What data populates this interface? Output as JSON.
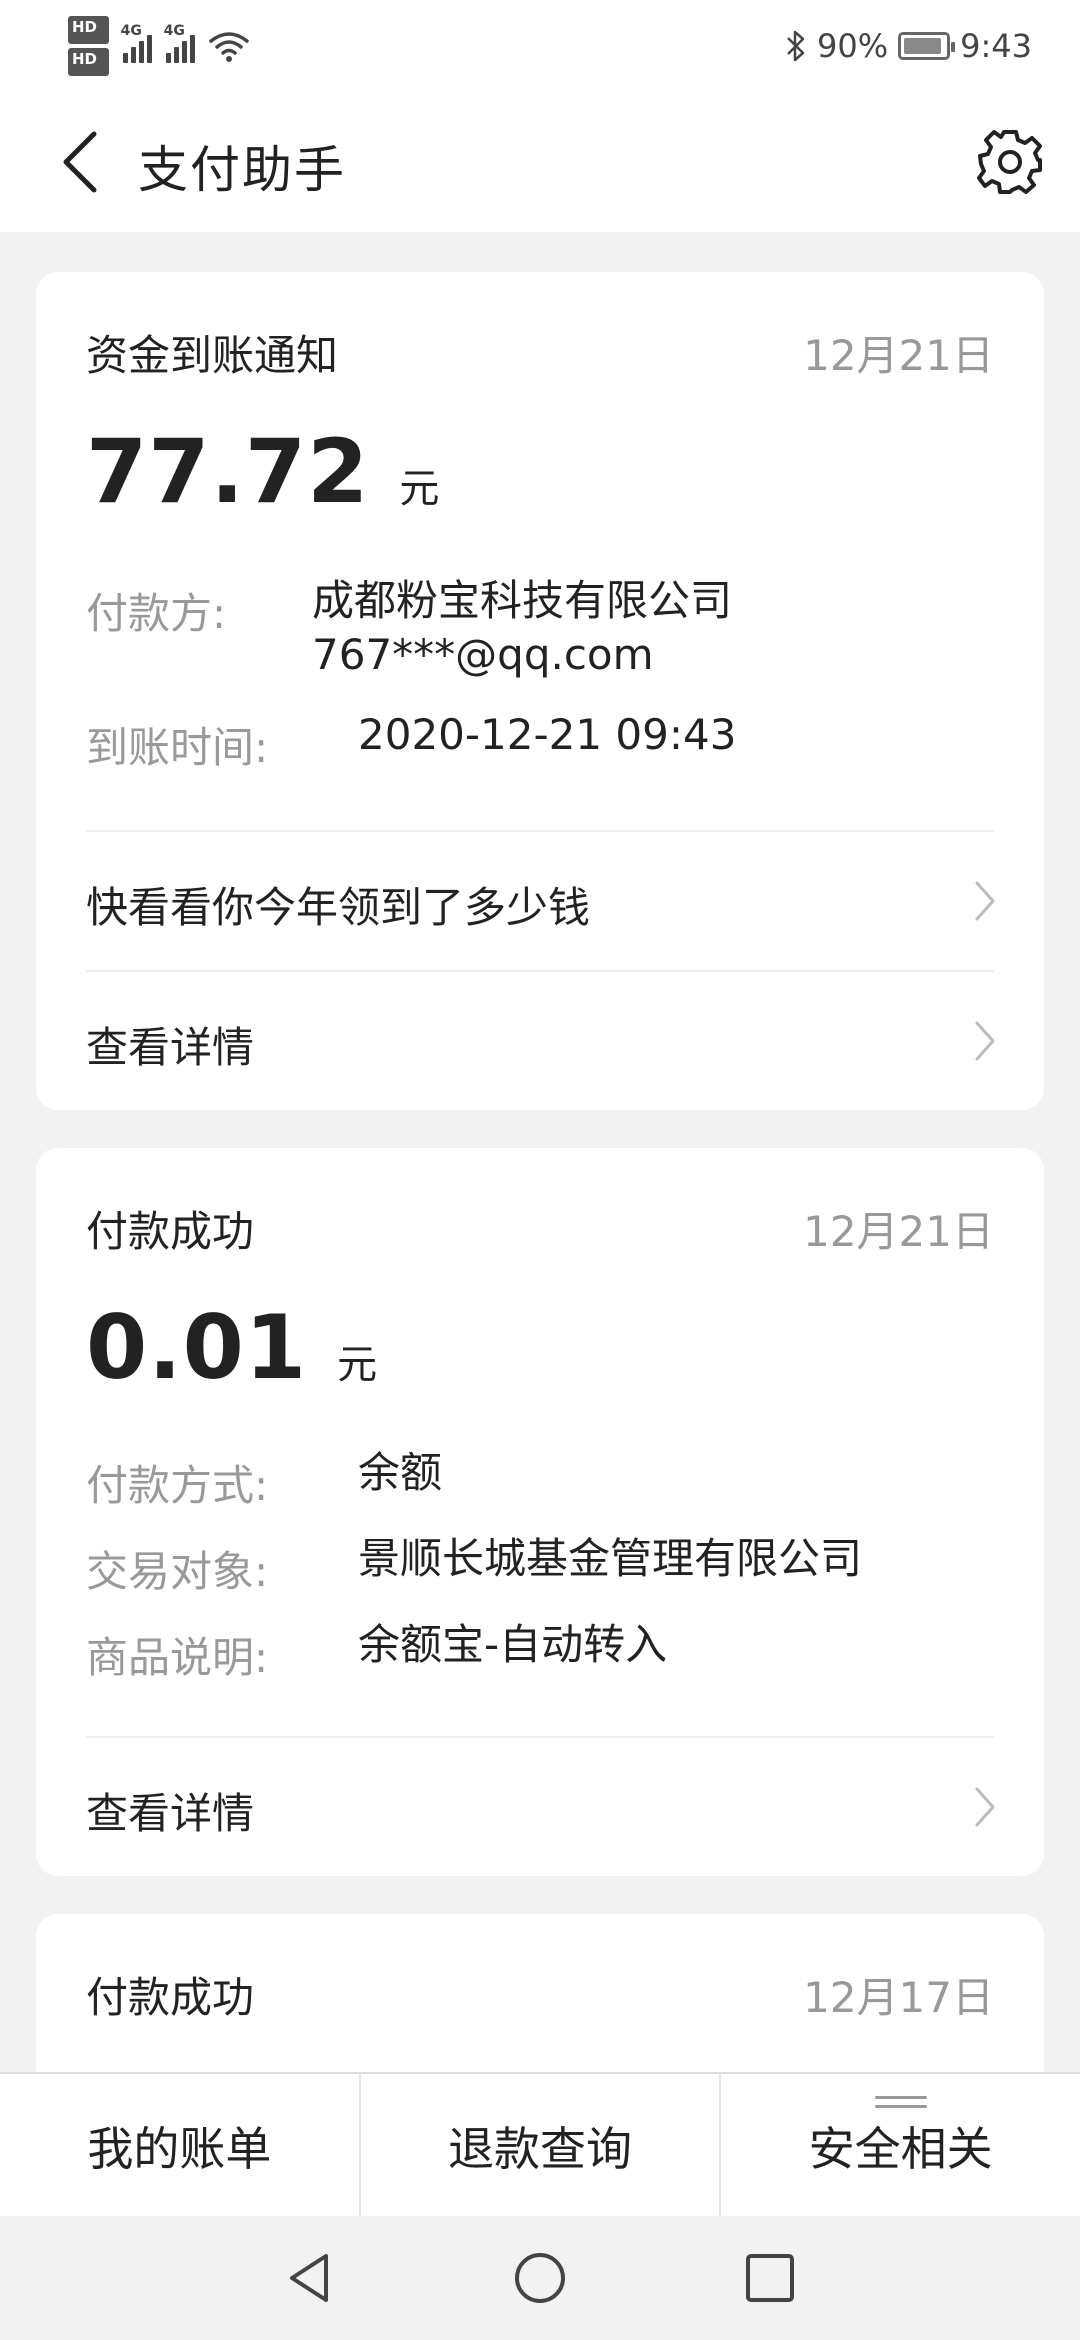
{
  "status_bar": {
    "hd1": "HD",
    "hd1_index": "1",
    "hd2": "HD",
    "hd2_index": "2",
    "net1": "4G",
    "net2": "4G",
    "battery_text": "90%",
    "time": "9:43"
  },
  "header": {
    "title": "支付助手",
    "back_icon": "chevron-left-icon",
    "settings_icon": "gear-icon"
  },
  "cards": [
    {
      "title": "资金到账通知",
      "date": "12月21日",
      "amount": "77.72",
      "unit": "元",
      "rows": [
        {
          "label": "付款方:",
          "value": "成都粉宝科技有限公司",
          "value2": "767***@qq.com"
        },
        {
          "label": "到账时间:",
          "value": "2020-12-21 09:43"
        }
      ],
      "links": [
        "快看看你今年领到了多少钱",
        "查看详情"
      ]
    },
    {
      "title": "付款成功",
      "date": "12月21日",
      "amount": "0.01",
      "unit": "元",
      "rows": [
        {
          "label": "付款方式:",
          "value": "余额"
        },
        {
          "label": "交易对象:",
          "value": "景顺长城基金管理有限公司"
        },
        {
          "label": "商品说明:",
          "value": "余额宝-自动转入"
        }
      ],
      "links": [
        "查看详情"
      ]
    },
    {
      "title": "付款成功",
      "date": "12月17日"
    }
  ],
  "bottom_tabs": [
    "我的账单",
    "退款查询",
    "安全相关"
  ],
  "colors": {
    "background": "#f2f2f2",
    "card": "#ffffff",
    "muted_text": "#999999",
    "primary_text": "#222222"
  }
}
